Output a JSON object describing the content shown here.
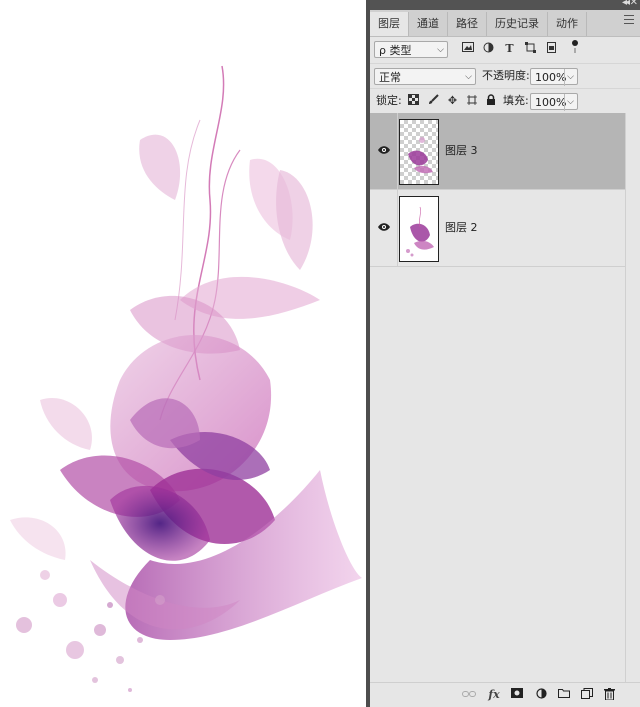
{
  "panel": {
    "tabs": [
      {
        "label": "图层"
      },
      {
        "label": "通道"
      },
      {
        "label": "路径"
      },
      {
        "label": "历史记录"
      },
      {
        "label": "动作"
      }
    ],
    "filter": {
      "kind_value": "ρ 类型"
    },
    "blend": {
      "mode_value": "正常",
      "opacity_label": "不透明度:",
      "opacity_value": "100%"
    },
    "lock": {
      "lock_label": "锁定:",
      "fill_label": "填充:",
      "fill_value": "100%"
    },
    "layers": [
      {
        "name": "图层 3",
        "selected": true
      },
      {
        "name": "图层 2",
        "selected": false
      }
    ],
    "footer": {
      "fx_label": "fx"
    }
  },
  "icons": [
    "link-icon",
    "fx-icon",
    "mask-icon",
    "adjustment-icon",
    "folder-icon",
    "new-layer-icon",
    "trash-icon",
    "eye-icon",
    "image-filter-icon",
    "adjust-filter-icon",
    "type-filter-icon",
    "shape-filter-icon",
    "smart-filter-icon",
    "lock-pixels-icon",
    "lock-paint-icon",
    "lock-move-icon",
    "lock-artboard-icon",
    "lock-all-icon"
  ],
  "colors": {
    "panel_bg": "#e6e6e6",
    "selected_layer": "#b5b5b5",
    "accent_purple": "#8b2c8f"
  }
}
